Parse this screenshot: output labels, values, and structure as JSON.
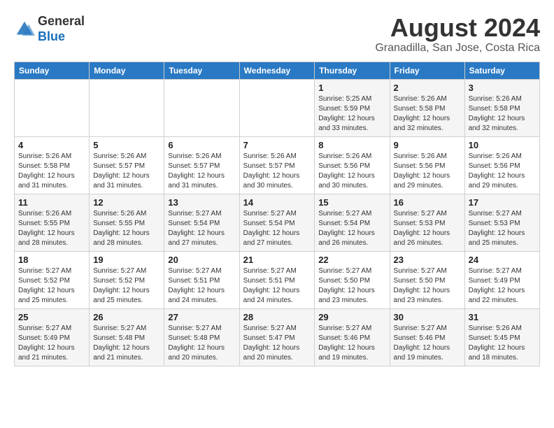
{
  "header": {
    "logo_general": "General",
    "logo_blue": "Blue",
    "month_title": "August 2024",
    "location": "Granadilla, San Jose, Costa Rica"
  },
  "days_of_week": [
    "Sunday",
    "Monday",
    "Tuesday",
    "Wednesday",
    "Thursday",
    "Friday",
    "Saturday"
  ],
  "weeks": [
    [
      {
        "day": "",
        "info": ""
      },
      {
        "day": "",
        "info": ""
      },
      {
        "day": "",
        "info": ""
      },
      {
        "day": "",
        "info": ""
      },
      {
        "day": "1",
        "info": "Sunrise: 5:25 AM\nSunset: 5:59 PM\nDaylight: 12 hours\nand 33 minutes."
      },
      {
        "day": "2",
        "info": "Sunrise: 5:26 AM\nSunset: 5:58 PM\nDaylight: 12 hours\nand 32 minutes."
      },
      {
        "day": "3",
        "info": "Sunrise: 5:26 AM\nSunset: 5:58 PM\nDaylight: 12 hours\nand 32 minutes."
      }
    ],
    [
      {
        "day": "4",
        "info": "Sunrise: 5:26 AM\nSunset: 5:58 PM\nDaylight: 12 hours\nand 31 minutes."
      },
      {
        "day": "5",
        "info": "Sunrise: 5:26 AM\nSunset: 5:57 PM\nDaylight: 12 hours\nand 31 minutes."
      },
      {
        "day": "6",
        "info": "Sunrise: 5:26 AM\nSunset: 5:57 PM\nDaylight: 12 hours\nand 31 minutes."
      },
      {
        "day": "7",
        "info": "Sunrise: 5:26 AM\nSunset: 5:57 PM\nDaylight: 12 hours\nand 30 minutes."
      },
      {
        "day": "8",
        "info": "Sunrise: 5:26 AM\nSunset: 5:56 PM\nDaylight: 12 hours\nand 30 minutes."
      },
      {
        "day": "9",
        "info": "Sunrise: 5:26 AM\nSunset: 5:56 PM\nDaylight: 12 hours\nand 29 minutes."
      },
      {
        "day": "10",
        "info": "Sunrise: 5:26 AM\nSunset: 5:56 PM\nDaylight: 12 hours\nand 29 minutes."
      }
    ],
    [
      {
        "day": "11",
        "info": "Sunrise: 5:26 AM\nSunset: 5:55 PM\nDaylight: 12 hours\nand 28 minutes."
      },
      {
        "day": "12",
        "info": "Sunrise: 5:26 AM\nSunset: 5:55 PM\nDaylight: 12 hours\nand 28 minutes."
      },
      {
        "day": "13",
        "info": "Sunrise: 5:27 AM\nSunset: 5:54 PM\nDaylight: 12 hours\nand 27 minutes."
      },
      {
        "day": "14",
        "info": "Sunrise: 5:27 AM\nSunset: 5:54 PM\nDaylight: 12 hours\nand 27 minutes."
      },
      {
        "day": "15",
        "info": "Sunrise: 5:27 AM\nSunset: 5:54 PM\nDaylight: 12 hours\nand 26 minutes."
      },
      {
        "day": "16",
        "info": "Sunrise: 5:27 AM\nSunset: 5:53 PM\nDaylight: 12 hours\nand 26 minutes."
      },
      {
        "day": "17",
        "info": "Sunrise: 5:27 AM\nSunset: 5:53 PM\nDaylight: 12 hours\nand 25 minutes."
      }
    ],
    [
      {
        "day": "18",
        "info": "Sunrise: 5:27 AM\nSunset: 5:52 PM\nDaylight: 12 hours\nand 25 minutes."
      },
      {
        "day": "19",
        "info": "Sunrise: 5:27 AM\nSunset: 5:52 PM\nDaylight: 12 hours\nand 25 minutes."
      },
      {
        "day": "20",
        "info": "Sunrise: 5:27 AM\nSunset: 5:51 PM\nDaylight: 12 hours\nand 24 minutes."
      },
      {
        "day": "21",
        "info": "Sunrise: 5:27 AM\nSunset: 5:51 PM\nDaylight: 12 hours\nand 24 minutes."
      },
      {
        "day": "22",
        "info": "Sunrise: 5:27 AM\nSunset: 5:50 PM\nDaylight: 12 hours\nand 23 minutes."
      },
      {
        "day": "23",
        "info": "Sunrise: 5:27 AM\nSunset: 5:50 PM\nDaylight: 12 hours\nand 23 minutes."
      },
      {
        "day": "24",
        "info": "Sunrise: 5:27 AM\nSunset: 5:49 PM\nDaylight: 12 hours\nand 22 minutes."
      }
    ],
    [
      {
        "day": "25",
        "info": "Sunrise: 5:27 AM\nSunset: 5:49 PM\nDaylight: 12 hours\nand 21 minutes."
      },
      {
        "day": "26",
        "info": "Sunrise: 5:27 AM\nSunset: 5:48 PM\nDaylight: 12 hours\nand 21 minutes."
      },
      {
        "day": "27",
        "info": "Sunrise: 5:27 AM\nSunset: 5:48 PM\nDaylight: 12 hours\nand 20 minutes."
      },
      {
        "day": "28",
        "info": "Sunrise: 5:27 AM\nSunset: 5:47 PM\nDaylight: 12 hours\nand 20 minutes."
      },
      {
        "day": "29",
        "info": "Sunrise: 5:27 AM\nSunset: 5:46 PM\nDaylight: 12 hours\nand 19 minutes."
      },
      {
        "day": "30",
        "info": "Sunrise: 5:27 AM\nSunset: 5:46 PM\nDaylight: 12 hours\nand 19 minutes."
      },
      {
        "day": "31",
        "info": "Sunrise: 5:26 AM\nSunset: 5:45 PM\nDaylight: 12 hours\nand 18 minutes."
      }
    ]
  ]
}
